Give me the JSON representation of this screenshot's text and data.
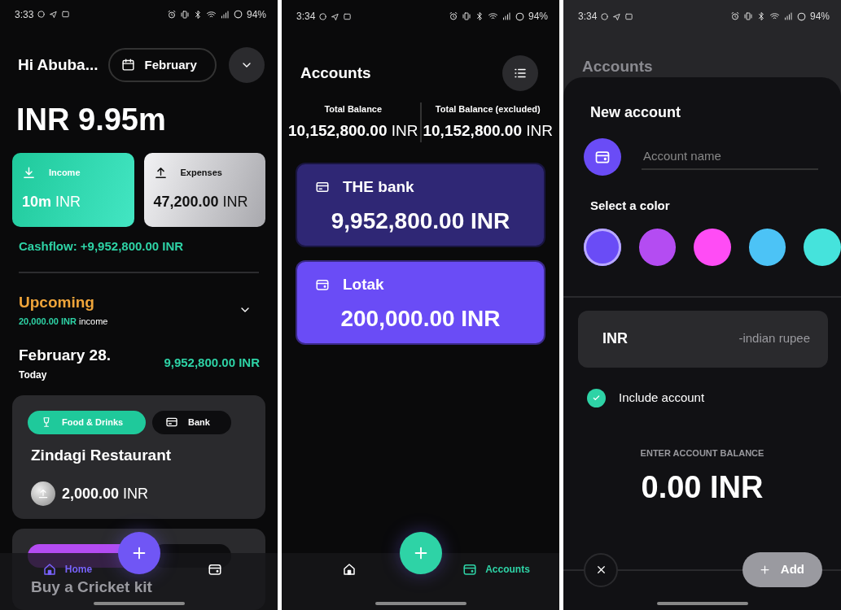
{
  "screens": [
    {
      "kind": "home",
      "status_bar": {
        "time": "3:33",
        "battery": "94%"
      },
      "greeting": "Hi Abuba...",
      "month_button": "February",
      "balance": "INR 9.95m",
      "summary": [
        {
          "kind": "income",
          "label": "Income",
          "amount": "10m",
          "currency": "INR"
        },
        {
          "kind": "expenses",
          "label": "Expenses",
          "amount": "47,200.00",
          "currency": "INR"
        }
      ],
      "cashflow": "Cashflow: +9,952,800.00 INR",
      "upcoming": {
        "title": "Upcoming",
        "amount": "20,000.00 INR",
        "suffix": "income"
      },
      "day": {
        "date": "February 28.",
        "label": "Today",
        "total": "9,952,800.00 INR"
      },
      "transactions": [
        {
          "category": "Food & Drinks",
          "color": "#1fc99b",
          "account": "Bank",
          "title": "Zindagi Restaurant",
          "amount": "2,000.00",
          "currency": "INR"
        },
        {
          "color": "#b44cf2",
          "title": "Buy a Cricket kit"
        }
      ],
      "nav": [
        {
          "kind": "home",
          "label": "Home",
          "selected": true
        },
        {
          "kind": "accounts",
          "selected": false
        }
      ]
    },
    {
      "kind": "accounts",
      "status_bar": {
        "time": "3:34",
        "battery": "94%"
      },
      "title": "Accounts",
      "totals": [
        {
          "label": "Total Balance",
          "amount": "10,152,800.00",
          "currency": "INR"
        },
        {
          "label": "Total Balance (excluded)",
          "amount": "10,152,800.00",
          "currency": "INR"
        }
      ],
      "accounts": [
        {
          "kind": "card",
          "name": "THE bank",
          "balance": "9,952,800.00 INR",
          "color": "#2f2775"
        },
        {
          "kind": "wallet",
          "name": "Lotak",
          "balance": "200,000.00 INR",
          "color": "#6a4cf6"
        }
      ],
      "nav": [
        {
          "kind": "home",
          "selected": false
        },
        {
          "kind": "accounts",
          "label": "Accounts",
          "selected": true
        }
      ]
    },
    {
      "kind": "new_account",
      "status_bar": {
        "time": "3:34",
        "battery": "94%"
      },
      "background_title": "Accounts",
      "title": "New account",
      "name_field": {
        "placeholder": "Account name"
      },
      "color_label": "Select a color",
      "colors": [
        {
          "color": "#6a4cf6",
          "selected": true
        },
        {
          "color": "#b44cf2",
          "selected": false
        },
        {
          "color": "#ff4cf5",
          "selected": false
        },
        {
          "color": "#4cc3f6",
          "selected": false
        },
        {
          "color": "#45e3dc",
          "selected": false
        }
      ],
      "currency": {
        "code": "INR",
        "name": "-indian rupee"
      },
      "include": {
        "label": "Include account",
        "checked": true
      },
      "balance_label": "ENTER ACCOUNT BALANCE",
      "balance": "0.00 INR",
      "add_button": "Add"
    }
  ]
}
